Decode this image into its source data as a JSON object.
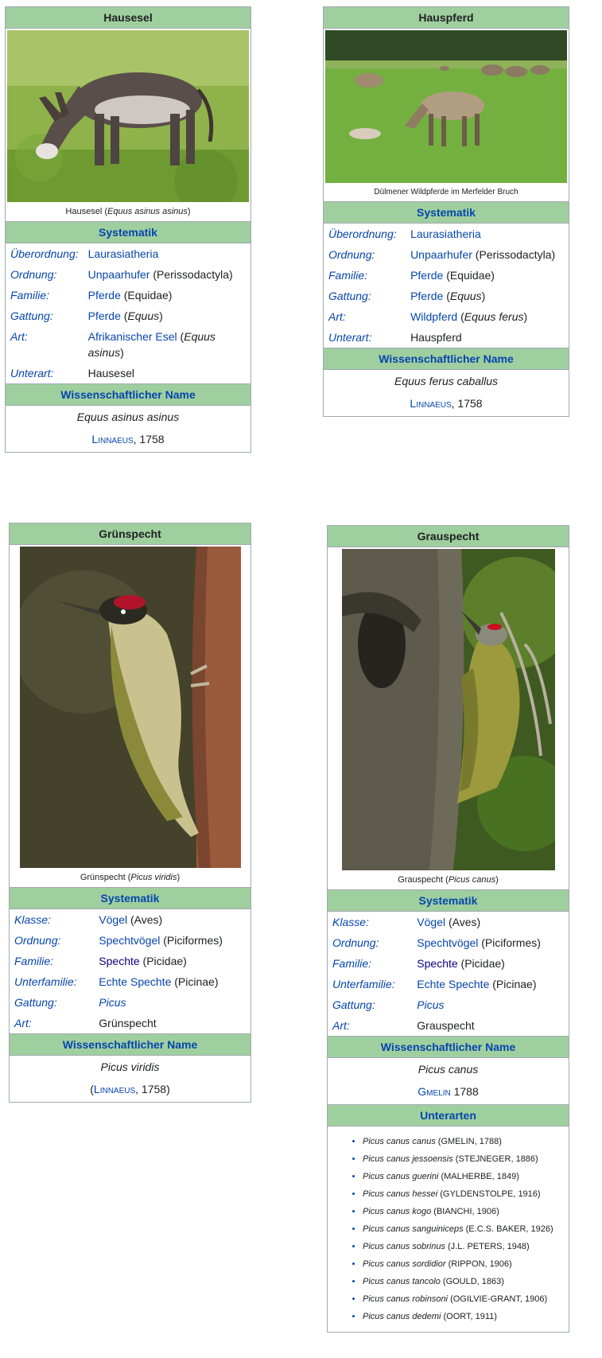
{
  "hausesel": {
    "title": "Hausesel",
    "caption_name": "Hausesel",
    "caption_sci": "Equus asinus asinus",
    "systematik": "Systematik",
    "rows": [
      {
        "rank": "Überordnung:",
        "link": "Laurasiatheria",
        "rest": ""
      },
      {
        "rank": "Ordnung:",
        "link": "Unpaarhufer",
        "rest": " (Perissodactyla)"
      },
      {
        "rank": "Familie:",
        "link": "Pferde",
        "rest": " (Equidae)"
      },
      {
        "rank": "Gattung:",
        "link": "Pferde",
        "rest_pre": " (",
        "rest_it": "Equus",
        "rest_post": ")"
      },
      {
        "rank": "Art:",
        "link": "Afrikanischer Esel",
        "rest_pre": " (",
        "rest_it": "Equus asinus",
        "rest_post": ")"
      },
      {
        "rank": "Unterart:",
        "plain": "Hausesel"
      }
    ],
    "wiss_header": "Wissenschaftlicher Name",
    "wiss_name": "Equus asinus asinus",
    "author": "Linnaeus",
    "year": ", 1758"
  },
  "hauspferd": {
    "title": "Hauspferd",
    "caption": "Dülmener Wildpferde im Merfelder Bruch",
    "systematik": "Systematik",
    "rows": [
      {
        "rank": "Überordnung:",
        "link": "Laurasiatheria"
      },
      {
        "rank": "Ordnung:",
        "link": "Unpaarhufer",
        "rest": " (Perissodactyla)"
      },
      {
        "rank": "Familie:",
        "link": "Pferde",
        "rest": " (Equidae)"
      },
      {
        "rank": "Gattung:",
        "link": "Pferde",
        "rest_pre": " (",
        "rest_it": "Equus",
        "rest_post": ")"
      },
      {
        "rank": "Art:",
        "link": "Wildpferd",
        "rest_pre": " (",
        "rest_it": "Equus ferus",
        "rest_post": ")"
      },
      {
        "rank": "Unterart:",
        "plain": "Hauspferd"
      }
    ],
    "wiss_header": "Wissenschaftlicher Name",
    "wiss_name": "Equus ferus caballus",
    "author": "Linnaeus",
    "year": ", 1758"
  },
  "gruenspecht": {
    "title": "Grünspecht",
    "caption_name": "Grünspecht",
    "caption_sci": "Picus viridis",
    "systematik": "Systematik",
    "rows": [
      {
        "rank": "Klasse:",
        "link": "Vögel",
        "rest": " (Aves)"
      },
      {
        "rank": "Ordnung:",
        "link": "Spechtvögel",
        "rest": " (Piciformes)"
      },
      {
        "rank": "Familie:",
        "link": "Spechte",
        "rest": " (Picidae)"
      },
      {
        "rank": "Unterfamilie:",
        "link": "Echte Spechte",
        "rest": " (Picinae)"
      },
      {
        "rank": "Gattung:",
        "link_it": "Picus"
      },
      {
        "rank": "Art:",
        "plain": "Grünspecht"
      }
    ],
    "wiss_header": "Wissenschaftlicher Name",
    "wiss_name": "Picus viridis",
    "author_pre": "(",
    "author": "Linnaeus",
    "year": ", 1758)"
  },
  "grauspecht": {
    "title": "Grauspecht",
    "caption_name": "Grauspecht",
    "caption_sci": "Picus canus",
    "systematik": "Systematik",
    "rows": [
      {
        "rank": "Klasse:",
        "link": "Vögel",
        "rest": " (Aves)"
      },
      {
        "rank": "Ordnung:",
        "link": "Spechtvögel",
        "rest": " (Piciformes)"
      },
      {
        "rank": "Familie:",
        "link": "Spechte",
        "rest": " (Picidae)"
      },
      {
        "rank": "Unterfamilie:",
        "link": "Echte Spechte",
        "rest": " (Picinae)"
      },
      {
        "rank": "Gattung:",
        "link_it": "Picus"
      },
      {
        "rank": "Art:",
        "plain": "Grauspecht"
      }
    ],
    "wiss_header": "Wissenschaftlicher Name",
    "wiss_name": "Picus canus",
    "author": "Gmelin",
    "year": " 1788",
    "unterarten_header": "Unterarten",
    "unterarten": [
      {
        "name": "Picus canus canus",
        "auth": " (GMELIN, 1788)"
      },
      {
        "name": "Picus canus jessoensis",
        "auth": " (STEJNEGER, 1886)"
      },
      {
        "name": "Picus canus guerini",
        "auth": " (MALHERBE, 1849)"
      },
      {
        "name": "Picus canus hessei",
        "auth": " (GYLDENSTOLPE, 1916)"
      },
      {
        "name": "Picus canus kogo",
        "auth": " (BIANCHI, 1906)"
      },
      {
        "name": "Picus canus sanguiniceps",
        "auth": " (E.C.S. BAKER, 1926)"
      },
      {
        "name": "Picus canus sobrinus",
        "auth": " (J.L. PETERS, 1948)"
      },
      {
        "name": "Picus canus sordidior",
        "auth": " (RIPPON, 1906)"
      },
      {
        "name": "Picus canus tancolo",
        "auth": " (GOULD, 1863)"
      },
      {
        "name": "Picus canus robinsoni",
        "auth": " (OGILVIE-GRANT, 1906)"
      },
      {
        "name": "Picus canus dedemi",
        "auth": " (OORT, 1911)"
      }
    ]
  }
}
